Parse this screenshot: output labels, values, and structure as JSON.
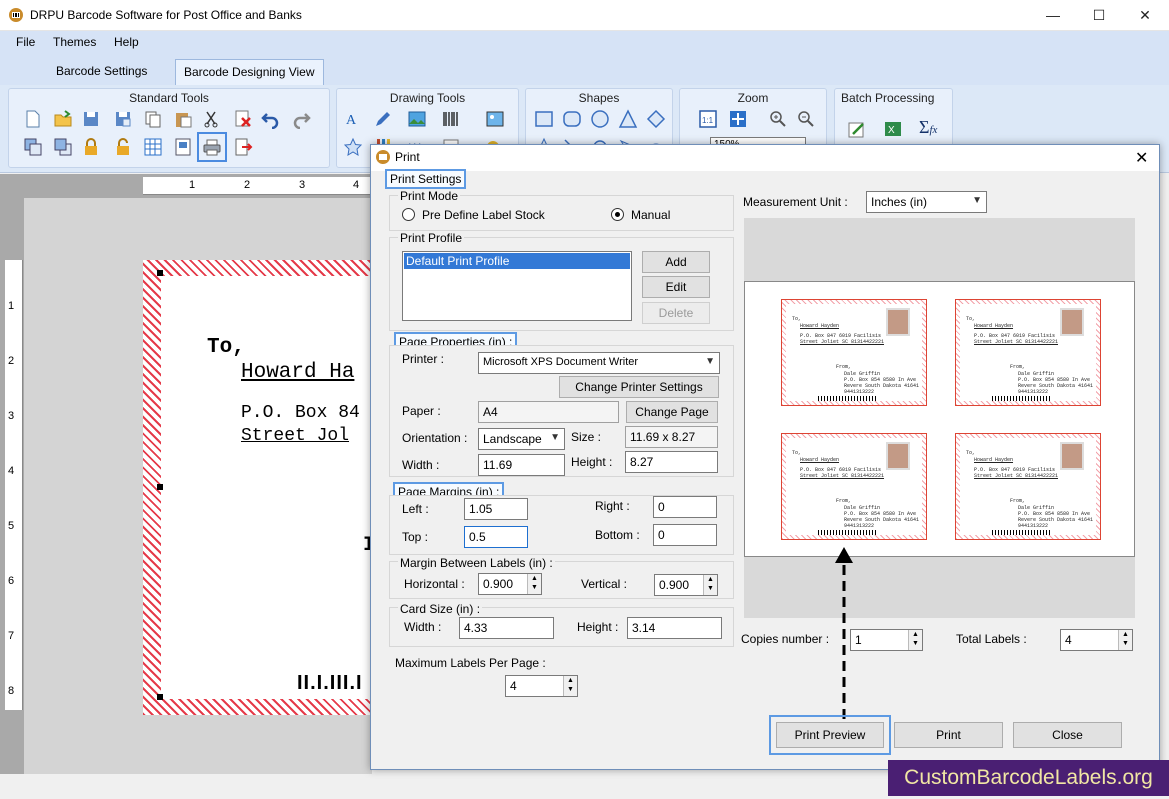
{
  "app": {
    "title": "DRPU Barcode Software for Post Office and Banks",
    "menu": [
      "File",
      "Themes",
      "Help"
    ],
    "tabs": [
      "Barcode Settings",
      "Barcode Designing View"
    ],
    "ribbon_groups": [
      "Standard Tools",
      "Drawing Tools",
      "Shapes",
      "Zoom",
      "Batch Processing"
    ],
    "zoom_value": "150%"
  },
  "canvas": {
    "hruler": [
      "1",
      "2",
      "3",
      "4"
    ],
    "vruler": [
      "1",
      "2",
      "3",
      "4",
      "5",
      "6",
      "7",
      "8"
    ],
    "label": {
      "to": "To,",
      "name": "Howard Ha",
      "line1": "P.O. Box 84",
      "line2": "Street Jol",
      "frag": "I",
      "barcode": "II.I.III.I"
    }
  },
  "dialog": {
    "title": "Print",
    "print_settings": "Print Settings",
    "print_mode": {
      "label": "Print Mode",
      "options": [
        "Pre Define Label Stock",
        "Manual"
      ],
      "selected": "Manual"
    },
    "print_profile": {
      "label": "Print Profile",
      "items": [
        "Default Print Profile"
      ],
      "add": "Add",
      "edit": "Edit",
      "delete": "Delete"
    },
    "page_properties": {
      "label": "Page Properties (in) :",
      "printer_label": "Printer :",
      "printer": "Microsoft XPS Document Writer",
      "change_printer": "Change Printer Settings",
      "paper_label": "Paper :",
      "paper": "A4",
      "change_page": "Change Page",
      "orientation_label": "Orientation :",
      "orientation": "Landscape",
      "size_label": "Size :",
      "size": "11.69 x 8.27",
      "width_label": "Width :",
      "width": "11.69",
      "height_label": "Height :",
      "height": "8.27"
    },
    "page_margins": {
      "label": "Page Margins (in) :",
      "left_label": "Left :",
      "left": "1.05",
      "right_label": "Right :",
      "right": "0",
      "top_label": "Top :",
      "top": "0.5",
      "bottom_label": "Bottom :",
      "bottom": "0"
    },
    "margin_between": {
      "label": "Margin Between Labels (in) :",
      "horizontal_label": "Horizontal :",
      "horizontal": "0.900",
      "vertical_label": "Vertical :",
      "vertical": "0.900"
    },
    "card_size": {
      "label": "Card Size (in) :",
      "width_label": "Width :",
      "width": "4.33",
      "height_label": "Height :",
      "height": "3.14"
    },
    "max_labels": {
      "label": "Maximum Labels Per Page :",
      "value": "4"
    },
    "measurement_unit": {
      "label": "Measurement Unit :",
      "value": "Inches (in)"
    },
    "preview_label": {
      "to": "To,",
      "name": "Howard Hayden",
      "line1": "P.O. Box 847 6019 Facilisis",
      "line2": "Street Joliet SC 81314422221",
      "from": "From,",
      "from_name": "Dale Griffin",
      "from_line1": "P.O. Box 854 8580 In Ave",
      "from_line2": "Revere South Dakota 41641",
      "from_line3": "9441313222"
    },
    "copies": {
      "label": "Copies number :",
      "value": "1"
    },
    "total_labels": {
      "label": "Total Labels :",
      "value": "4"
    },
    "buttons": {
      "preview": "Print Preview",
      "print": "Print",
      "close": "Close"
    }
  },
  "watermark": "CustomBarcodeLabels.org",
  "colors": {
    "ribbon": "#dce8f7",
    "highlight": "#5d9ae3",
    "label_stripe": "#e53b4a",
    "watermark_bg": "#4a1f73",
    "watermark_fg": "#f1e7a4"
  }
}
